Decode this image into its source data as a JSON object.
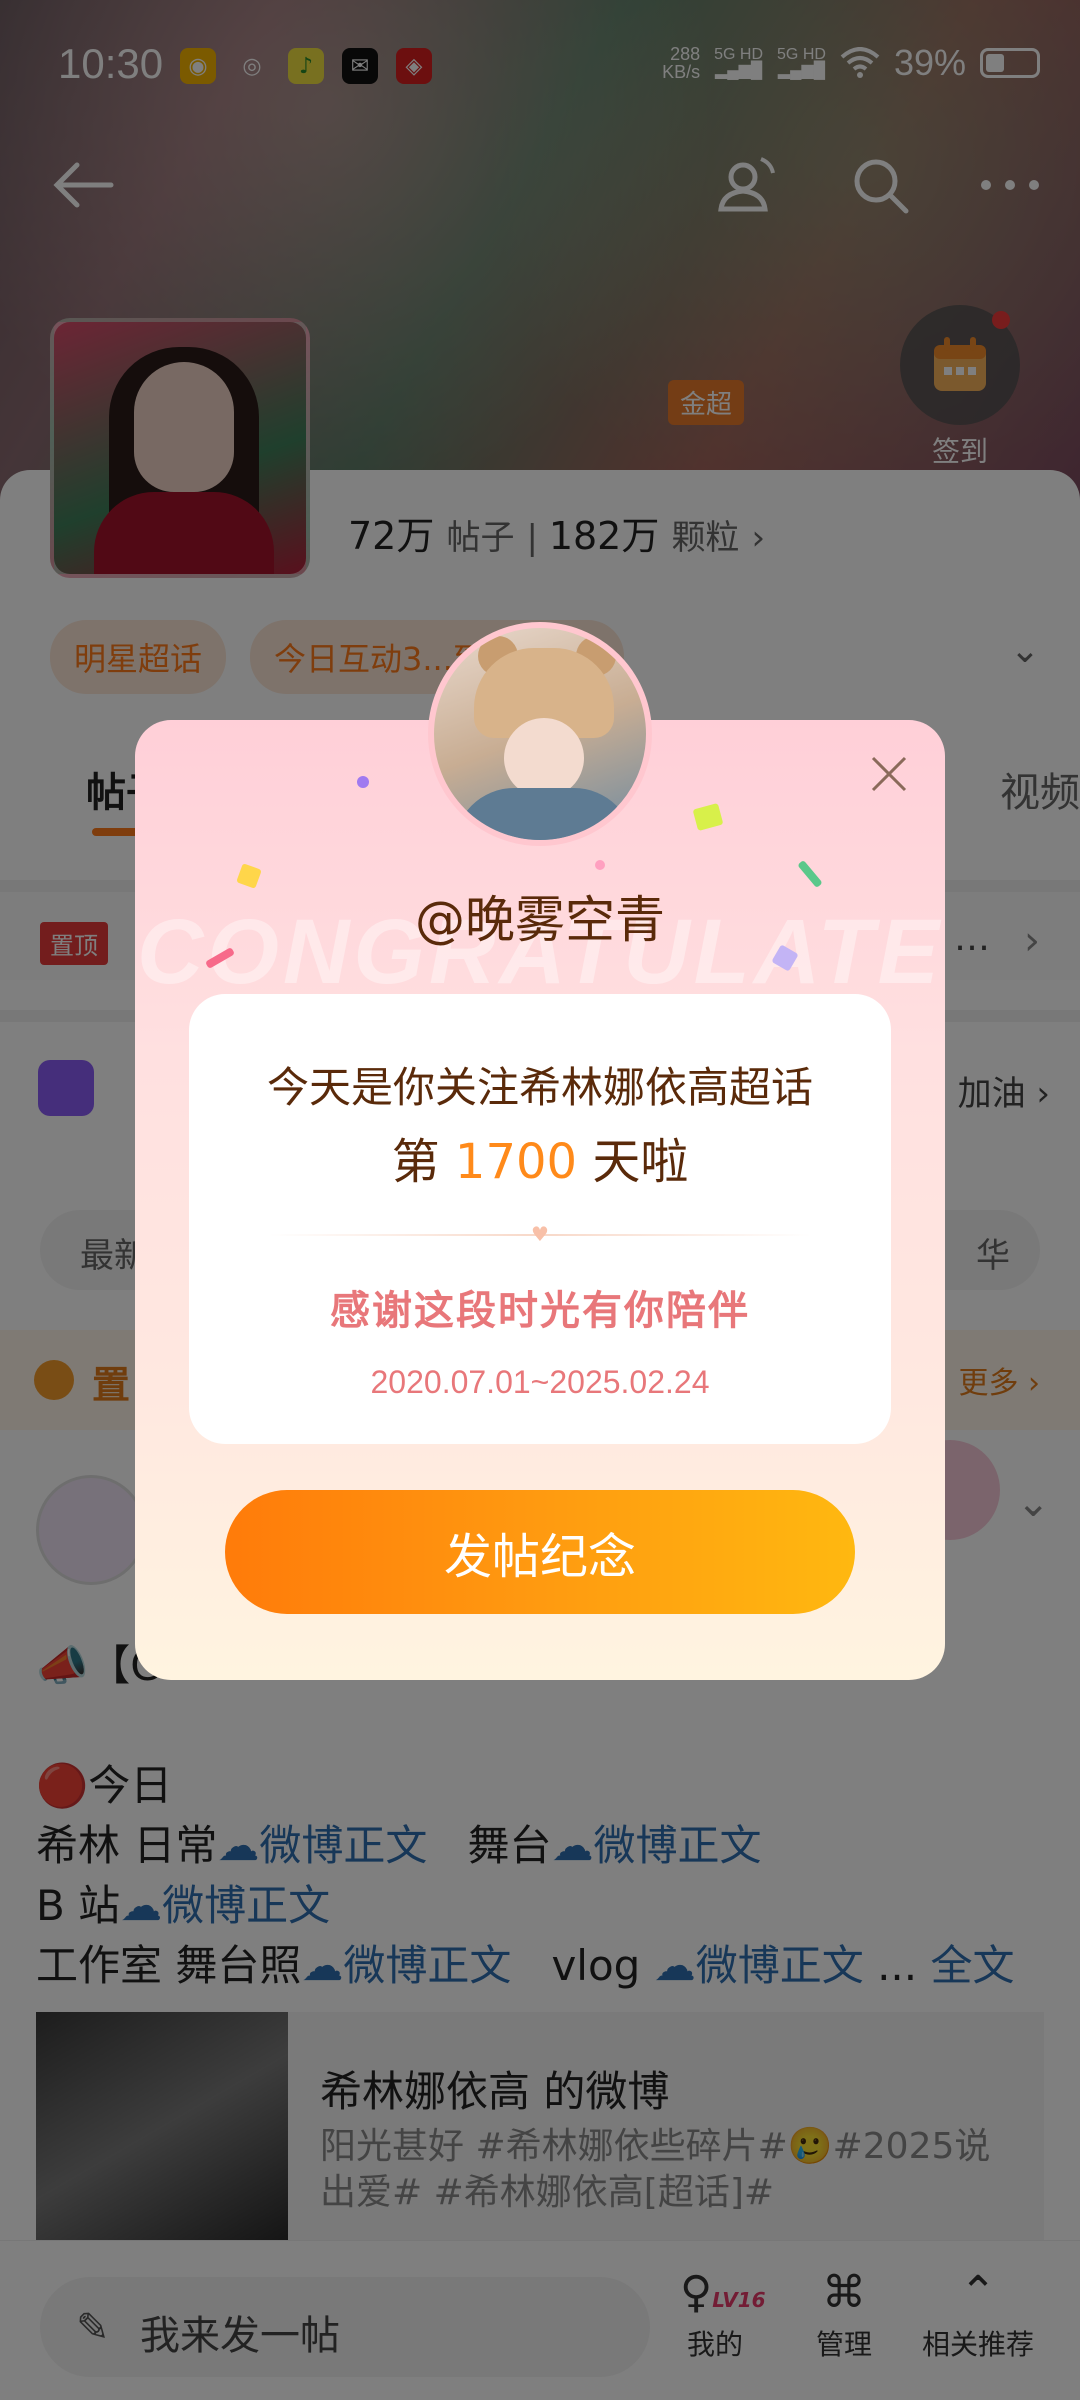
{
  "status": {
    "time": "10:30",
    "net_speed_value": "288",
    "net_speed_unit": "KB/s",
    "sig1": "5G HD",
    "sig2": "5G HD",
    "battery": "39%"
  },
  "header": {
    "level_tag": "金超",
    "checkin_label": "签到"
  },
  "stats": {
    "posts_count": "72万",
    "posts_label": "帖子",
    "particles_count": "182万",
    "particles_label": "颗粒"
  },
  "chips": [
    {
      "label": "明星超话"
    },
    {
      "label": "今日互动3...到1.8万人"
    }
  ],
  "tabs": {
    "left": "帖子",
    "right": "视频"
  },
  "pinned_row": {
    "badge": "置顶",
    "dots": "…"
  },
  "task_row": {
    "text": "加油"
  },
  "sort_row": {
    "left": "最新",
    "right": "华"
  },
  "pinned_section": {
    "title": "置",
    "more": "更多"
  },
  "post": {
    "line1_prefix": "📣【C",
    "line2": "🔴今日",
    "line3_a": "希林 日常",
    "line3_link1": "微博正文",
    "line3_b": "舞台",
    "line3_link2": "微博正文",
    "line4_a": "B 站",
    "line4_link": "微博正文",
    "line5_a": "工作室 舞台照",
    "line5_link1": "微博正文",
    "line5_b": "vlog",
    "line5_link2": "微博正文",
    "line5_ellipsis": "...",
    "full_text": "全文"
  },
  "embed_card": {
    "title": "希林娜依高 的微博",
    "desc": "阳光甚好 #希林娜依些碎片#🥲#2025说出爱# #希林娜依高[超话]#"
  },
  "bottom_bar": {
    "compose_placeholder": "我来发一帖",
    "level": "LV16",
    "mine": "我的",
    "manage": "管理",
    "related": "相关推荐"
  },
  "modal": {
    "handle": "@晚雾空青",
    "watermark": "CONGRATULATE",
    "line1": "今天是你关注希林娜依高超话",
    "line2_prefix": "第",
    "days": "1700",
    "line2_suffix": "天啦",
    "thanks": "感谢这段时光有你陪伴",
    "dates": "2020.07.01~2025.02.24",
    "cta": "发帖纪念"
  },
  "colors": {
    "accent": "#ff7a1a",
    "link": "#2f6fb0",
    "pink_text": "#e8777a"
  }
}
